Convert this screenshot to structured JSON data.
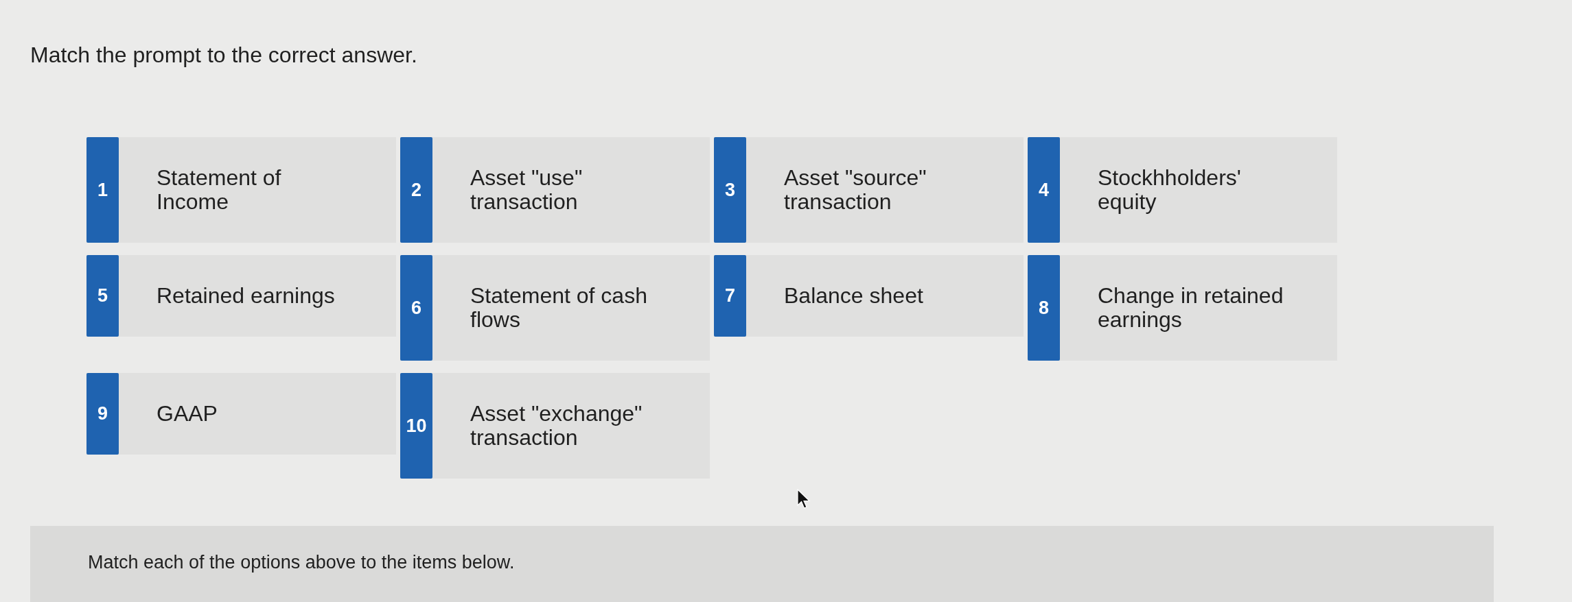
{
  "prompt": "Match the prompt to the correct answer.",
  "options": [
    {
      "number": "1",
      "text": "Statement of Income"
    },
    {
      "number": "2",
      "text": "Asset \"use\" transaction"
    },
    {
      "number": "3",
      "text": "Asset \"source\" transaction"
    },
    {
      "number": "4",
      "text": "Stockhholders' equity"
    },
    {
      "number": "5",
      "text": "Retained earnings"
    },
    {
      "number": "6",
      "text": "Statement of cash flows"
    },
    {
      "number": "7",
      "text": "Balance sheet"
    },
    {
      "number": "8",
      "text": "Change in retained earnings"
    },
    {
      "number": "9",
      "text": "GAAP"
    },
    {
      "number": "10",
      "text": "Asset \"exchange\" transaction"
    }
  ],
  "instructions": "Match each of the options above to the items below."
}
